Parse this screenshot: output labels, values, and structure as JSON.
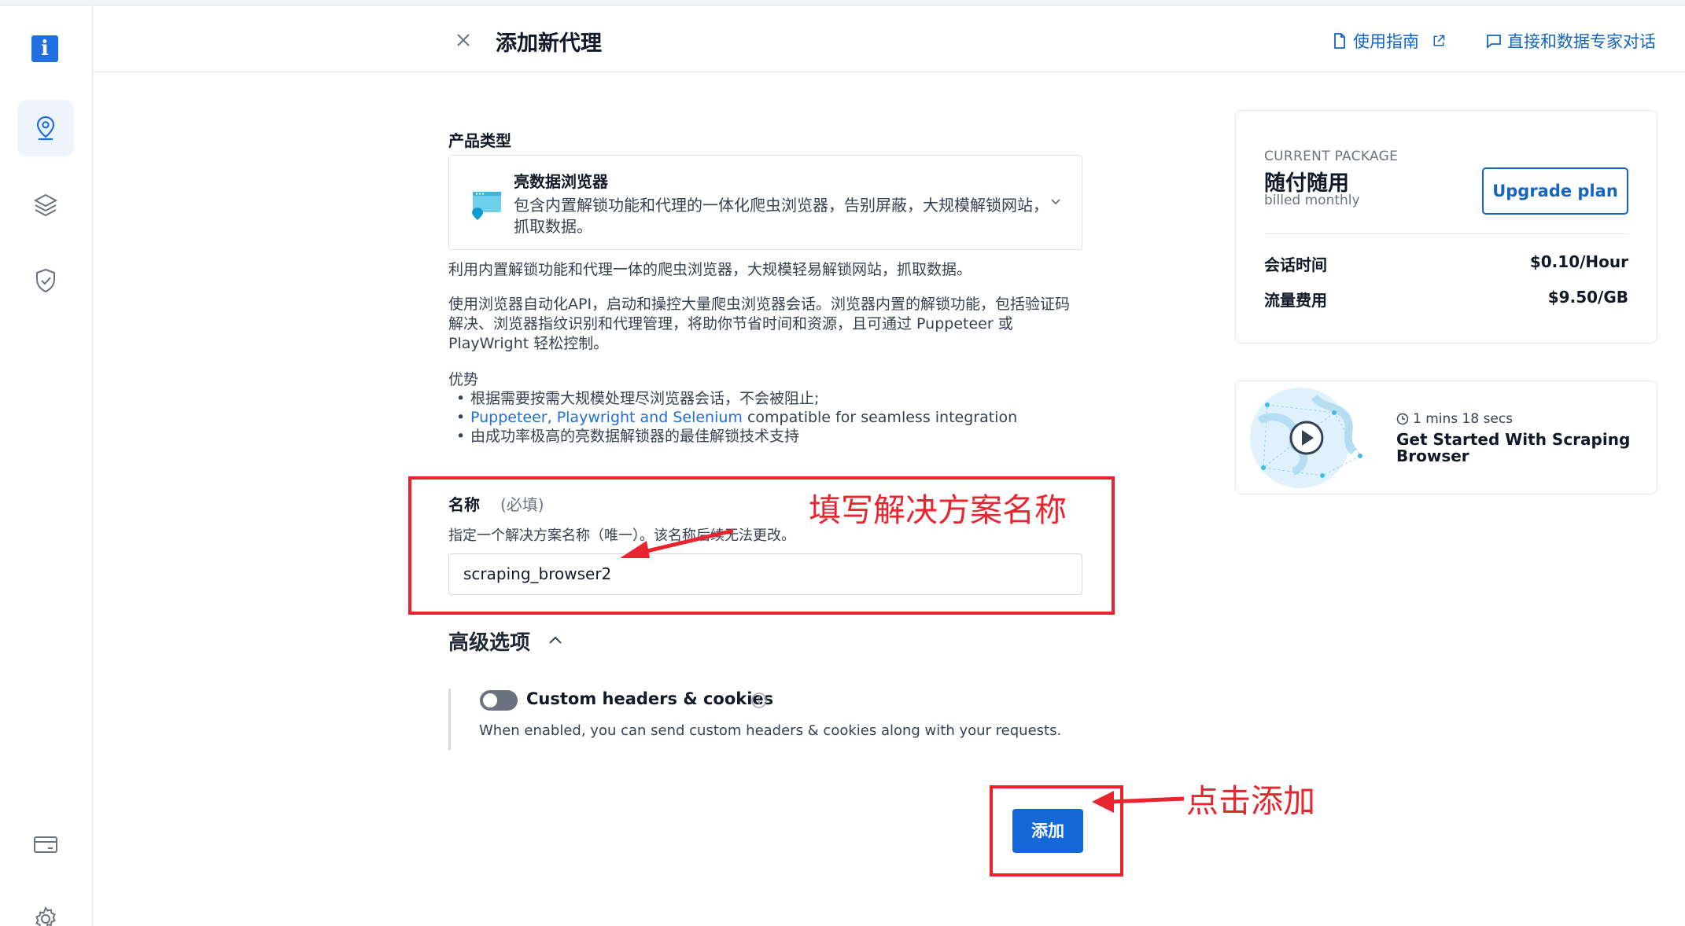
{
  "header": {
    "title": "添加新代理",
    "guide_link": "使用指南",
    "expert_link": "直接和数据专家对话"
  },
  "sidebar": {
    "logo_letter": "i",
    "items": [
      {
        "icon": "location-pin-icon",
        "active": true
      },
      {
        "icon": "layers-icon",
        "active": false
      },
      {
        "icon": "shield-check-icon",
        "active": false
      },
      {
        "icon": "billing-card-icon",
        "active": false
      },
      {
        "icon": "gear-icon",
        "active": false
      }
    ]
  },
  "product": {
    "section_label": "产品类型",
    "name": "亮数据浏览器",
    "description": "包含内置解锁功能和代理的一体化爬虫浏览器，告别屏蔽，大规模解锁网站，抓取数据。",
    "summary": "利用内置解锁功能和代理一体的爬虫浏览器，大规模轻易解锁网站，抓取数据。",
    "detail": "使用浏览器自动化API，启动和操控大量爬虫浏览器会话。浏览器内置的解锁功能，包括验证码解决、浏览器指纹识别和代理管理，将助你节省时间和资源，且可通过 Puppeteer 或 PlayWright 轻松控制。",
    "advantages_label": "优势",
    "advantages": [
      {
        "link": "",
        "text": "根据需要按需大规模处理尽浏览器会话，不会被阻止;"
      },
      {
        "link": "Puppeteer, Playwright and Selenium",
        "text": " compatible for seamless integration"
      },
      {
        "link": "",
        "text": "由成功率极高的亮数据解锁器的最佳解锁技术支持"
      }
    ]
  },
  "name_field": {
    "label": "名称",
    "required": "(必填)",
    "hint": "指定一个解决方案名称（唯一）。该名称后续无法更改。",
    "value": "scraping_browser2"
  },
  "advanced": {
    "title": "高级选项",
    "toggle_label": "Custom headers & cookies",
    "toggle_on": false,
    "toggle_desc": "When enabled, you can send custom headers & cookies along with your requests."
  },
  "submit": {
    "label": "添加"
  },
  "package": {
    "caption": "CURRENT PACKAGE",
    "name": "随付随用",
    "billing": "billed monthly",
    "upgrade_label": "Upgrade plan",
    "fees": [
      {
        "label": "会话时间",
        "value": "$0.10/Hour"
      },
      {
        "label": "流量费用",
        "value": "$9.50/GB"
      }
    ]
  },
  "video": {
    "duration": "1 mins 18 secs",
    "title": "Get Started With Scraping Browser"
  },
  "annotations": {
    "name_hint": "填写解决方案名称",
    "click_hint": "点击添加",
    "color": "#e8252e"
  }
}
